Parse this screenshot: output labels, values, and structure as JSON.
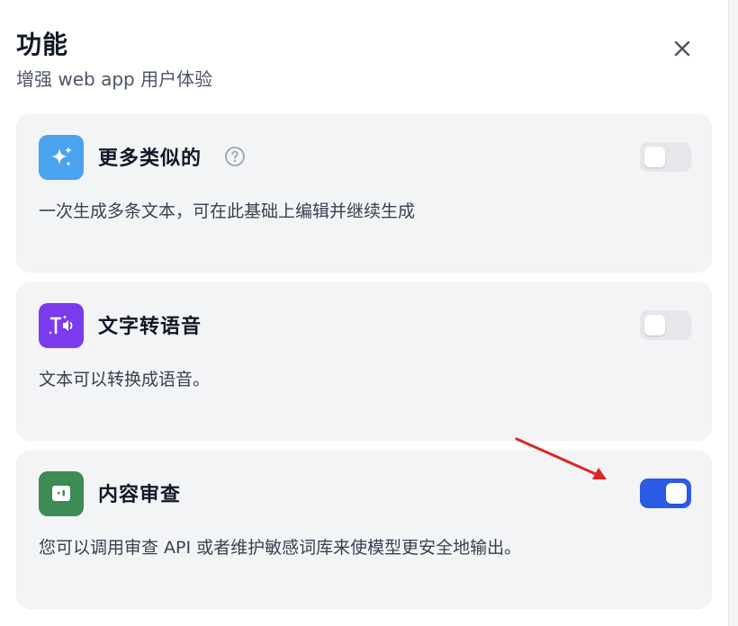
{
  "header": {
    "title": "功能",
    "subtitle": "增强 web app 用户体验",
    "close_icon": "close-icon"
  },
  "features": [
    {
      "title": "更多类似的",
      "description": "一次生成多条文本，可在此基础上编辑并继续生成",
      "icon": "sparkles-icon",
      "icon_color": "#4aa3ee",
      "has_help": true,
      "enabled": false
    },
    {
      "title": "文字转语音",
      "description": "文本可以转换成语音。",
      "icon": "text-to-speech-icon",
      "icon_color": "#7c3aed",
      "has_help": false,
      "enabled": false
    },
    {
      "title": "内容审查",
      "description": "您可以调用审查 API 或者维护敏感词库来使模型更安全地输出。",
      "icon": "moderation-icon",
      "icon_color": "#3d8b55",
      "has_help": false,
      "enabled": true
    }
  ],
  "colors": {
    "toggle_on": "#2b5ae5",
    "toggle_off": "#e5e7eb",
    "annotation_arrow": "#e02424"
  }
}
